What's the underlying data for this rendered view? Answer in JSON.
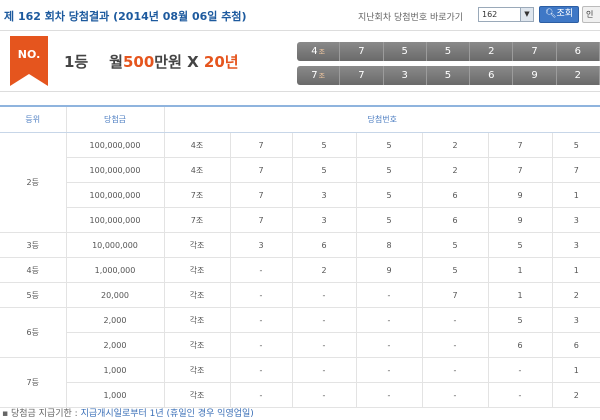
{
  "header": {
    "title": "제 162 회차 당첨결과 (2014년 08월 06일 추첨)",
    "jump_label": "지난회차 당첨번호 바로가기",
    "round_select_value": "162",
    "search_label": "조회",
    "extra_button_label": "인"
  },
  "winner": {
    "badge": "NO.",
    "rank": "1등",
    "prize_prefix": "월",
    "prize_amount": "500",
    "prize_unit": "만원 X",
    "prize_years": "20년"
  },
  "winning_numbers": [
    {
      "jo_number": "4",
      "jo_suffix": "조",
      "digits": [
        "7",
        "5",
        "5",
        "2",
        "7",
        "6"
      ]
    },
    {
      "jo_number": "7",
      "jo_suffix": "조",
      "digits": [
        "7",
        "3",
        "5",
        "6",
        "9",
        "2"
      ]
    }
  ],
  "table": {
    "headers": {
      "rank": "등위",
      "prize": "당첨금",
      "numbers": "당첨번호"
    },
    "rows": [
      {
        "rank": "2등",
        "prize": "100,000,000",
        "jo": "4조",
        "d": [
          "7",
          "5",
          "5",
          "2",
          "7",
          "5"
        ]
      },
      {
        "rank": "",
        "prize": "100,000,000",
        "jo": "4조",
        "d": [
          "7",
          "5",
          "5",
          "2",
          "7",
          "7"
        ]
      },
      {
        "rank": "",
        "prize": "100,000,000",
        "jo": "7조",
        "d": [
          "7",
          "3",
          "5",
          "6",
          "9",
          "1"
        ]
      },
      {
        "rank": "",
        "prize": "100,000,000",
        "jo": "7조",
        "d": [
          "7",
          "3",
          "5",
          "6",
          "9",
          "3"
        ]
      },
      {
        "rank": "3등",
        "prize": "10,000,000",
        "jo": "각조",
        "d": [
          "3",
          "6",
          "8",
          "5",
          "5",
          "3"
        ]
      },
      {
        "rank": "4등",
        "prize": "1,000,000",
        "jo": "각조",
        "d": [
          "-",
          "2",
          "9",
          "5",
          "1",
          "1"
        ]
      },
      {
        "rank": "5등",
        "prize": "20,000",
        "jo": "각조",
        "d": [
          "-",
          "-",
          "-",
          "7",
          "1",
          "2"
        ]
      },
      {
        "rank": "6등",
        "prize": "2,000",
        "jo": "각조",
        "d": [
          "-",
          "-",
          "-",
          "-",
          "5",
          "3"
        ]
      },
      {
        "rank": "",
        "prize": "2,000",
        "jo": "각조",
        "d": [
          "-",
          "-",
          "-",
          "-",
          "6",
          "6"
        ]
      },
      {
        "rank": "7등",
        "prize": "1,000",
        "jo": "각조",
        "d": [
          "-",
          "-",
          "-",
          "-",
          "-",
          "1"
        ]
      },
      {
        "rank": "",
        "prize": "1,000",
        "jo": "각조",
        "d": [
          "-",
          "-",
          "-",
          "-",
          "-",
          "2"
        ]
      }
    ]
  },
  "footer": {
    "label": "▪ 당첨금 지급기한 :",
    "value": "지급개시일로부터 1년 (휴일인 경우 익영업일)"
  },
  "colors": {
    "accent_orange": "#e5551e",
    "title_blue": "#1d5a9e",
    "number_bar_gray": "#7a7a7a"
  }
}
